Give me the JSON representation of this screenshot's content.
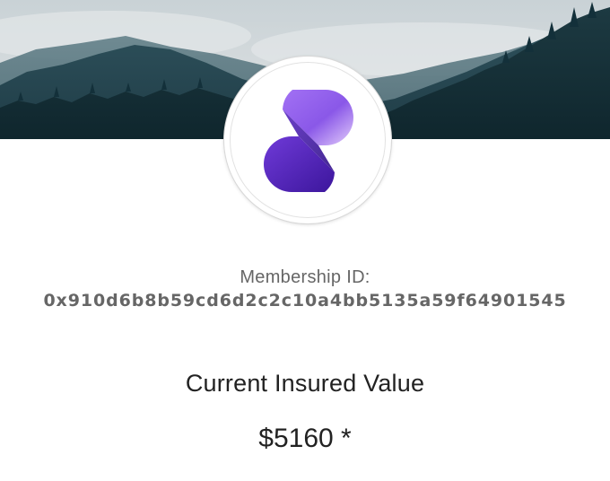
{
  "membership": {
    "label": "Membership ID:",
    "id": "0x910d6b8b59cd6d2c2c10a4bb5135a59f64901545"
  },
  "insurance": {
    "label": "Current Insured Value",
    "value": "$5160 *"
  },
  "colors": {
    "logo_top": "#9b6cf0",
    "logo_bottom": "#4b1fb0",
    "text_muted": "#666666",
    "text_dark": "#222222"
  },
  "icons": {
    "hero": "mountain-forest-banner",
    "logo": "brand-logo-8"
  }
}
